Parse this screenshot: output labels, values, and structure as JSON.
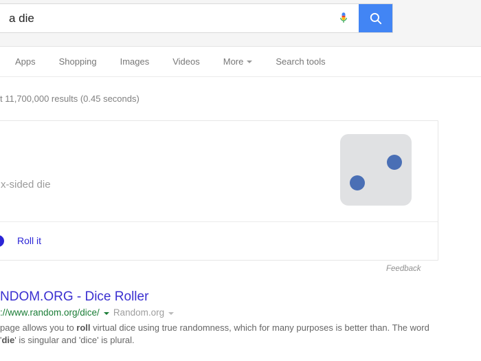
{
  "search": {
    "query_visible": "a die",
    "mic_icon": "microphone-icon",
    "search_icon": "magnifier-icon"
  },
  "nav": {
    "items": [
      {
        "label": "Apps",
        "has_caret": false
      },
      {
        "label": "Shopping",
        "has_caret": false
      },
      {
        "label": "Images",
        "has_caret": false
      },
      {
        "label": "Videos",
        "has_caret": false
      },
      {
        "label": "More",
        "has_caret": true
      },
      {
        "label": "Search tools",
        "has_caret": false
      }
    ]
  },
  "stats": {
    "text": "t 11,700,000 results (0.45 seconds)"
  },
  "widget": {
    "label": "x-sided die",
    "die_value": 2,
    "die_face_color": "#e0e1e3",
    "pip_color": "#4a6fb5",
    "roll_label": "Roll it",
    "roll_link_color": "#2b25d6",
    "feedback_label": "Feedback"
  },
  "result": {
    "title": "NDOM.ORG - Dice Roller",
    "url": "://www.random.org/dice/",
    "site": "Random.org",
    "snippet_pre": "page allows you to ",
    "snippet_bold1": "roll",
    "snippet_mid": " virtual dice using true randomness, which for many purposes is better than",
    "snippet_line2_pre": ". The word '",
    "snippet_bold2": "die",
    "snippet_line2_post": "' is singular and 'dice' is plural."
  }
}
